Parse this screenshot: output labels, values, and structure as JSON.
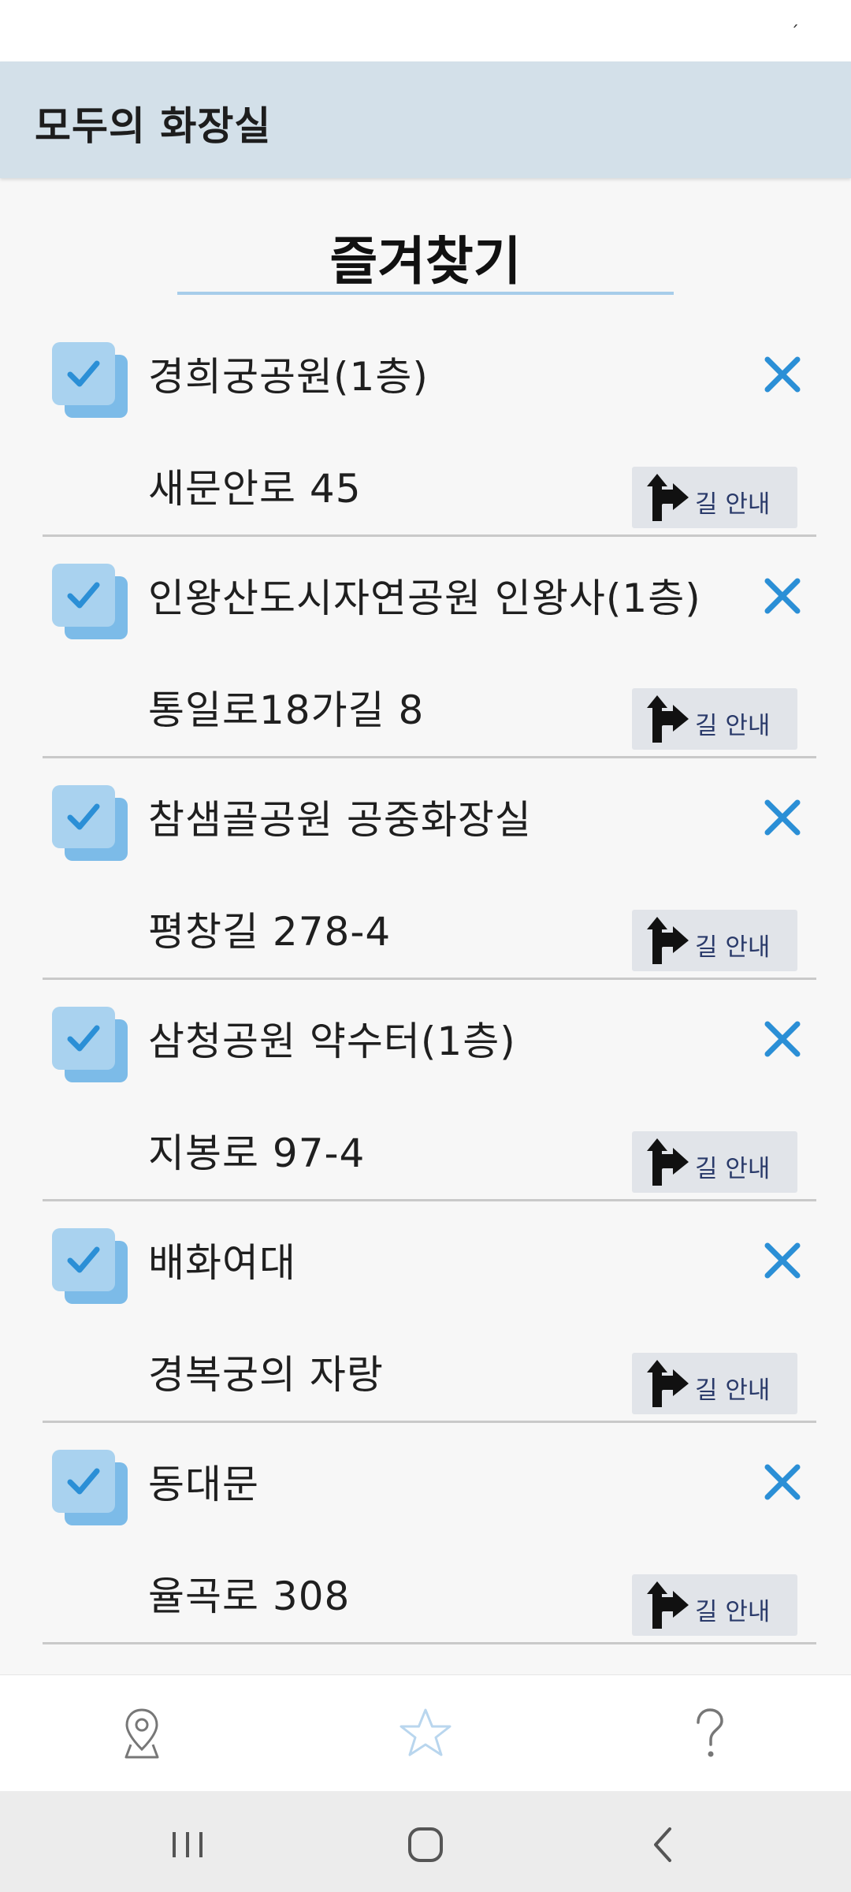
{
  "app": {
    "title": "모두의 화장실"
  },
  "status": {
    "indicator": "ˊ"
  },
  "page": {
    "title": "즐겨찾기"
  },
  "favorites": [
    {
      "checked": true,
      "name": "경희궁공원(1층)",
      "address": "새문안로 45"
    },
    {
      "checked": true,
      "name": "인왕산도시자연공원 인왕사(1층)",
      "address": "통일로18가길 8"
    },
    {
      "checked": true,
      "name": "참샘골공원 공중화장실",
      "address": "평창길 278-4"
    },
    {
      "checked": true,
      "name": "삼청공원 약수터(1층)",
      "address": "지봉로 97-4"
    },
    {
      "checked": true,
      "name": "배화여대",
      "address": "경복궁의 자랑"
    },
    {
      "checked": true,
      "name": "동대문",
      "address": "율곡로 308"
    }
  ],
  "row_actions": {
    "directions_label": "길 안내",
    "delete_icon": "close-icon",
    "directions_icon": "turn-arrow-icon"
  },
  "bottom_nav": [
    {
      "icon": "map-pin-icon",
      "active": false
    },
    {
      "icon": "star-icon",
      "active": true
    },
    {
      "icon": "help-icon",
      "active": false
    }
  ],
  "system_nav": [
    "recent-apps-icon",
    "home-icon",
    "back-icon"
  ],
  "colors": {
    "app_bar": "#d3e0e9",
    "accent": "#2b8fd6",
    "checkbox_light": "#a9d2ef",
    "checkbox_dark": "#7cbbe8",
    "button_bg": "#e1e4e9"
  }
}
